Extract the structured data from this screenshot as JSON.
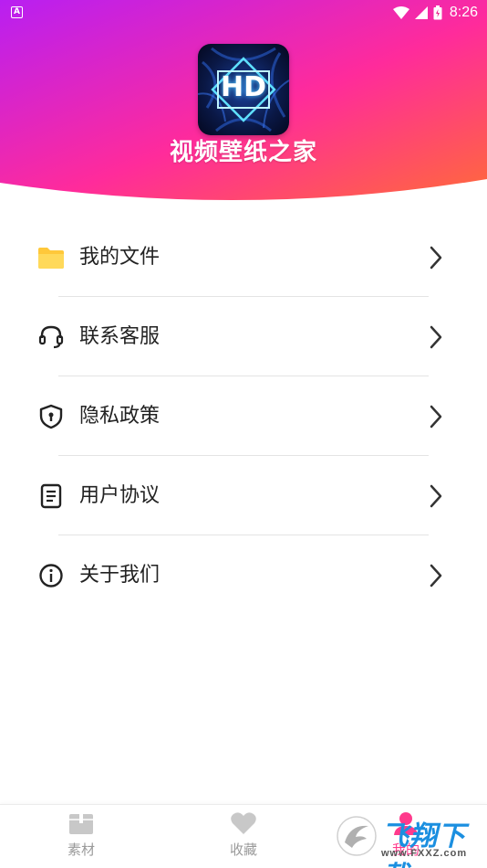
{
  "status_bar": {
    "time": "8:26",
    "left_badge": "A",
    "icons": [
      "wifi-icon",
      "signal-icon",
      "battery-icon"
    ]
  },
  "header": {
    "app_logo_text": "HD",
    "app_title": "视频壁纸之家",
    "gradient_colors": [
      "#c81ef0",
      "#ff2a9a",
      "#ff6a3d"
    ]
  },
  "menu": {
    "items": [
      {
        "label": "我的文件",
        "icon": "folder-icon"
      },
      {
        "label": "联系客服",
        "icon": "headset-icon"
      },
      {
        "label": "隐私政策",
        "icon": "shield-icon"
      },
      {
        "label": "用户协议",
        "icon": "document-icon"
      },
      {
        "label": "关于我们",
        "icon": "info-icon"
      }
    ]
  },
  "bottom_nav": {
    "items": [
      {
        "label": "素材",
        "icon": "box-icon",
        "active": false
      },
      {
        "label": "收藏",
        "icon": "heart-icon",
        "active": false
      },
      {
        "label": "我的",
        "icon": "user-icon",
        "active": true
      }
    ]
  },
  "watermark": {
    "text": "飞翔下载",
    "url": "www.FXXZ.com"
  },
  "colors": {
    "accent": "#ff2a9a",
    "folder": "#ffcc33",
    "text": "#222222",
    "muted": "#9a9a9a"
  }
}
